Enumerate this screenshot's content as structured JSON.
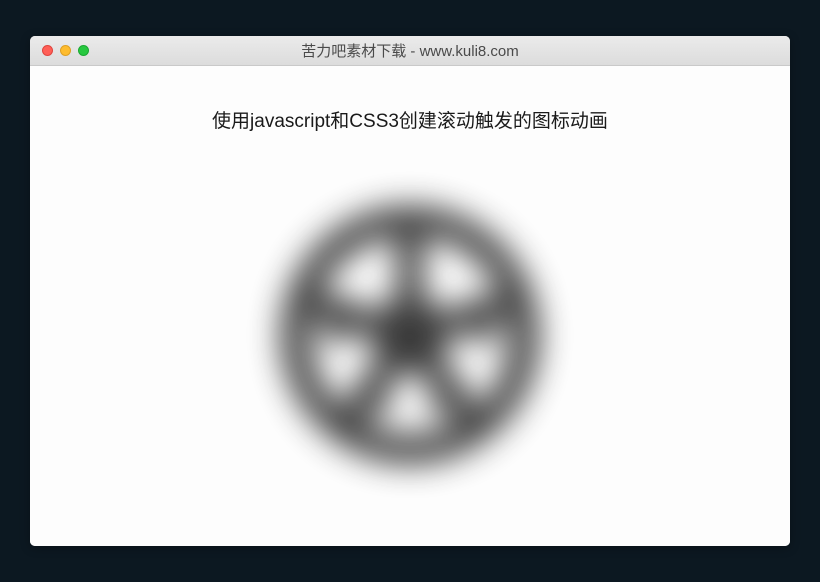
{
  "window": {
    "title": "苦力吧素材下载 - www.kuli8.com"
  },
  "content": {
    "heading": "使用javascript和CSS3创建滚动触发的图标动画",
    "icon_name": "soccer-ball-icon"
  },
  "colors": {
    "page_bg": "#0c1821",
    "window_bg": "#fdfdfd",
    "icon_fill": "#2a2a2a"
  }
}
